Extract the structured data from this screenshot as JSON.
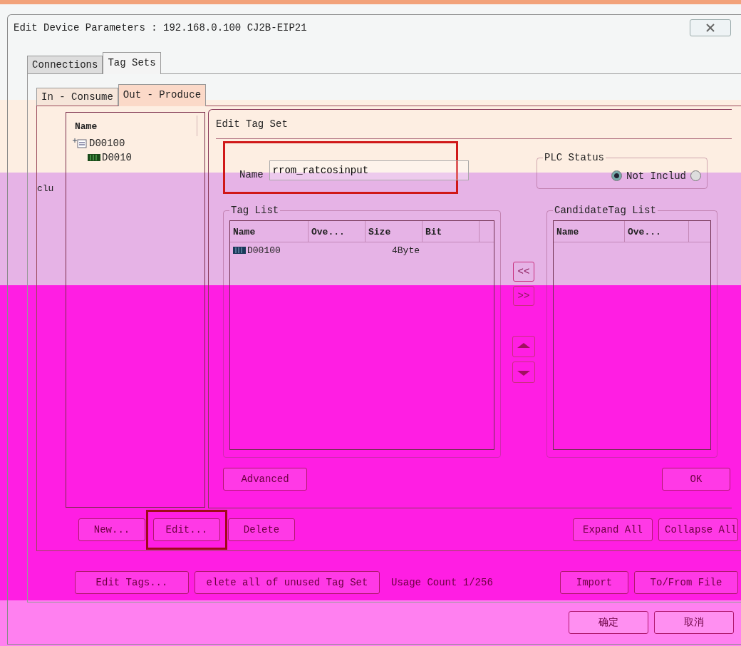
{
  "window": {
    "title": "Edit Device Parameters : 192.168.0.100 CJ2B-EIP21"
  },
  "tabs": [
    {
      "label": "Connections",
      "selected": false
    },
    {
      "label": "Tag Sets",
      "selected": true
    }
  ],
  "sub_tabs": [
    {
      "label": "In - Consume",
      "selected": false
    },
    {
      "label": "Out - Produce",
      "selected": true
    }
  ],
  "background_fragment": "clu",
  "tag_sets": {
    "column": "Name",
    "items": [
      {
        "label": "D00100",
        "expanded": true,
        "children": [
          {
            "label": "D0010"
          }
        ]
      }
    ]
  },
  "edit_tag_set": {
    "title": "Edit Tag Set",
    "name_label": "Name",
    "name_value": "rrom_ratcosinput",
    "plc_status": {
      "label": "PLC Status",
      "options": [
        {
          "label": "Not Includ",
          "selected": true
        },
        {
          "selected": false
        }
      ]
    },
    "tag_list": {
      "label": "Tag List",
      "columns": [
        "Name",
        "Ove...",
        "Size",
        "Bit"
      ],
      "rows": [
        {
          "cells": [
            "D00100",
            "",
            "4Byte",
            ""
          ]
        }
      ]
    },
    "move_buttons": [
      "<<",
      ">>"
    ],
    "candidate_list": {
      "label": "CandidateTag List",
      "columns": [
        "Name",
        "Ove..."
      ]
    },
    "advanced_button": "Advanced",
    "ok_button": "OK"
  },
  "list_buttons": [
    "New...",
    "Edit...",
    "Delete"
  ],
  "tree_buttons": [
    "Expand All",
    "Collapse All"
  ],
  "bottom_row": {
    "left_buttons": [
      "Edit Tags...",
      "elete all of unused Tag Set"
    ],
    "usage": "Usage Count 1/256",
    "right_buttons": [
      "Import",
      "To/From File"
    ]
  },
  "dialog_buttons": [
    "确定",
    "取消"
  ]
}
